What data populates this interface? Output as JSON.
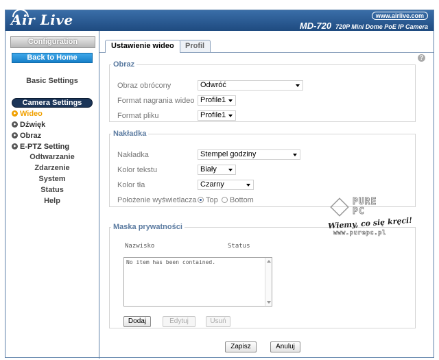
{
  "header": {
    "logo": "Air Live",
    "site_url": "www.airlive.com",
    "model": "MD-720",
    "model_desc": "720P Mini Dome PoE IP Camera"
  },
  "sidebar": {
    "configuration": "Configuration",
    "back_to_home": "Back to Home",
    "basic_settings": "Basic Settings",
    "camera_settings": "Camera Settings",
    "sub_items": [
      {
        "label": "Wideo",
        "active": true
      },
      {
        "label": "Dźwięk",
        "active": false
      },
      {
        "label": "Obraz",
        "active": false
      },
      {
        "label": "E-PTZ Setting",
        "active": false
      }
    ],
    "links": [
      "Odtwarzanie",
      "Zdarzenie",
      "System",
      "Status",
      "Help"
    ]
  },
  "main": {
    "tabs": [
      {
        "label": "Ustawienie wideo",
        "active": true
      },
      {
        "label": "Profil",
        "active": false
      }
    ],
    "help_icon": "?",
    "obraz": {
      "legend": "Obraz",
      "rows": [
        {
          "label": "Obraz obrócony",
          "value": "Odwróć"
        },
        {
          "label": "Format nagrania wideo",
          "value": "Profile1"
        },
        {
          "label": "Format pliku",
          "value": "Profile1"
        }
      ]
    },
    "nakladka": {
      "legend": "Nakładka",
      "rows": [
        {
          "label": "Nakładka",
          "value": "Stempel godziny"
        },
        {
          "label": "Kolor tekstu",
          "value": "Biały"
        },
        {
          "label": "Kolor tła",
          "value": "Czarny"
        }
      ],
      "position_label": "Położenie wyświetlacza",
      "position_options": [
        {
          "label": "Top",
          "checked": true
        },
        {
          "label": "Bottom",
          "checked": false
        }
      ]
    },
    "maska": {
      "legend": "Maska prywatności",
      "col_name": "Nazwisko",
      "col_status": "Status",
      "empty_text": "No item has been contained.",
      "buttons": [
        {
          "label": "Dodaj",
          "enabled": true
        },
        {
          "label": "Edytuj",
          "enabled": false
        },
        {
          "label": "Usuń",
          "enabled": false
        }
      ]
    },
    "save_button": "Zapisz",
    "cancel_button": "Anuluj"
  },
  "watermark": {
    "line1": "PURE",
    "line2": "PC",
    "slogan": "Wiemy, co się kręci!",
    "url": "www.purepc.pl"
  }
}
